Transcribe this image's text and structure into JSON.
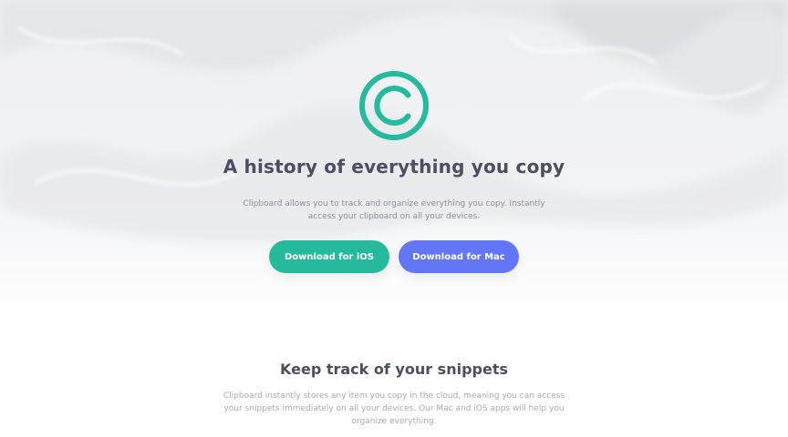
{
  "colors": {
    "accent_teal": "#26ba9c",
    "accent_blue": "#6476f8",
    "heading": "#4c4e61",
    "body_text": "#8d8e99"
  },
  "hero": {
    "logo_icon": "copyright-c-icon",
    "title": "A history of everything you copy",
    "description": "Clipboard allows you to track and organize everything you copy. Instantly access your clipboard on all your devices.",
    "ios_button_label": "Download for iOS",
    "mac_button_label": "Download for Mac"
  },
  "snippets_section": {
    "title": "Keep track of your snippets",
    "description": "Clipboard instantly stores any item you copy in the cloud, meaning you can access your snippets immediately on all your devices. Our Mac and iOS apps will help you organize everything."
  }
}
